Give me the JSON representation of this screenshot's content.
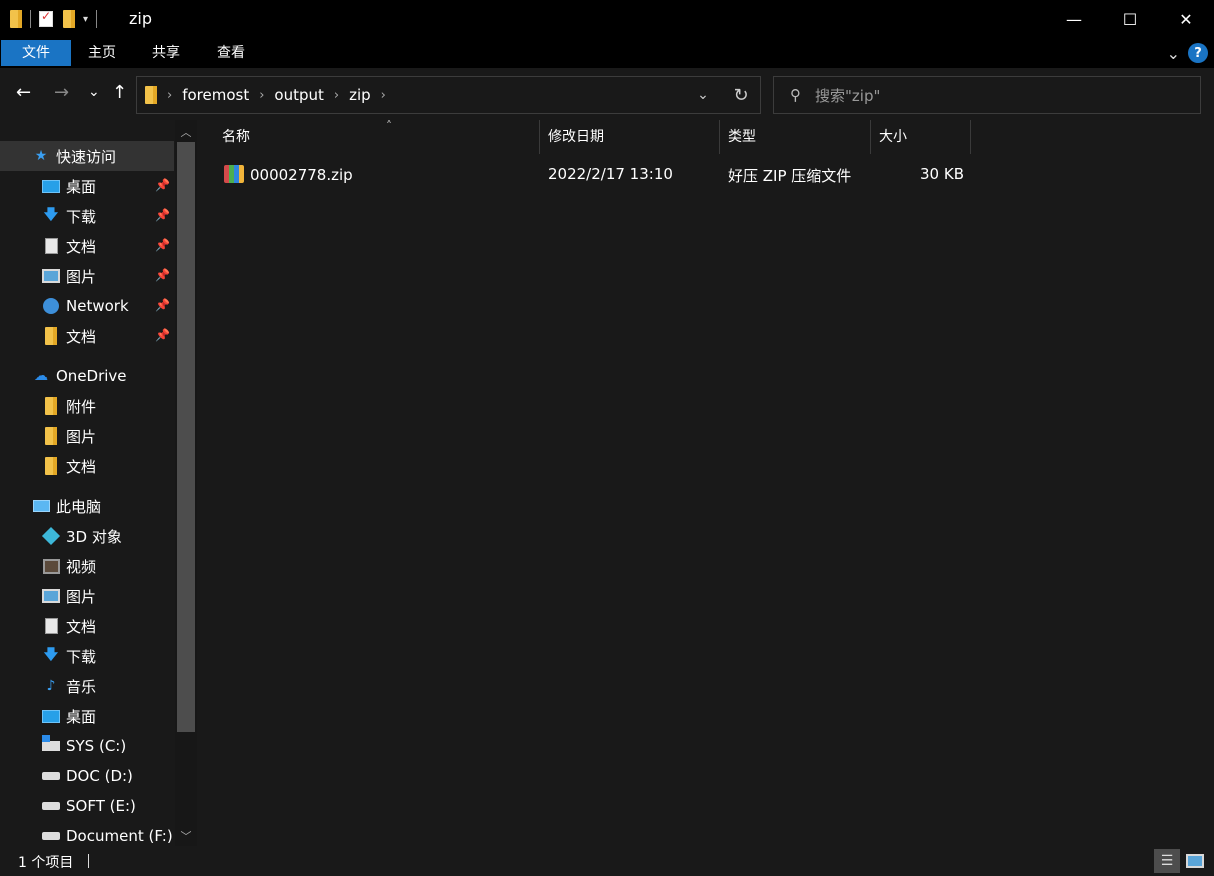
{
  "window": {
    "title": "zip",
    "minimize": "—",
    "maximize": "☐",
    "close": "✕"
  },
  "ribbon": {
    "tabs": [
      "文件",
      "主页",
      "共享",
      "查看"
    ],
    "expand": "⌄",
    "help": "?"
  },
  "nav": {
    "back": "←",
    "forward": "→",
    "recent": "⌄",
    "up": "↑",
    "breadcrumb": [
      "foremost",
      "output",
      "zip"
    ],
    "history_dropdown": "⌄",
    "refresh": "↻",
    "search_placeholder": "搜索\"zip\""
  },
  "sidebar": {
    "quick_access": "快速访问",
    "quick_items": [
      {
        "label": "桌面",
        "icon": "desktop-icon"
      },
      {
        "label": "下载",
        "icon": "download-icon"
      },
      {
        "label": "文档",
        "icon": "document-icon"
      },
      {
        "label": "图片",
        "icon": "pictures-icon"
      },
      {
        "label": "Network",
        "icon": "network-icon"
      },
      {
        "label": "文档",
        "icon": "folder-icon"
      }
    ],
    "onedrive": "OneDrive",
    "onedrive_items": [
      "附件",
      "图片",
      "文档"
    ],
    "this_pc": "此电脑",
    "pc_items": [
      {
        "label": "3D 对象",
        "icon": "3d-objects-icon"
      },
      {
        "label": "视频",
        "icon": "video-icon"
      },
      {
        "label": "图片",
        "icon": "pictures-icon"
      },
      {
        "label": "文档",
        "icon": "document-icon"
      },
      {
        "label": "下载",
        "icon": "download-icon"
      },
      {
        "label": "音乐",
        "icon": "music-icon"
      },
      {
        "label": "桌面",
        "icon": "desktop-icon"
      },
      {
        "label": "SYS (C:)",
        "icon": "system-drive-icon"
      },
      {
        "label": "DOC (D:)",
        "icon": "drive-icon"
      },
      {
        "label": "SOFT (E:)",
        "icon": "drive-icon"
      },
      {
        "label": "Document (F:)",
        "icon": "drive-icon"
      }
    ]
  },
  "columns": {
    "name": "名称",
    "modified": "修改日期",
    "type": "类型",
    "size": "大小"
  },
  "files": [
    {
      "name": "00002778.zip",
      "modified": "2022/2/17 13:10",
      "type": "好压 ZIP 压缩文件",
      "size": "30 KB"
    }
  ],
  "status": {
    "count": "1 个项目"
  },
  "colors": {
    "accent": "#1a74c4",
    "background": "#191919",
    "titlebar": "#000000"
  }
}
